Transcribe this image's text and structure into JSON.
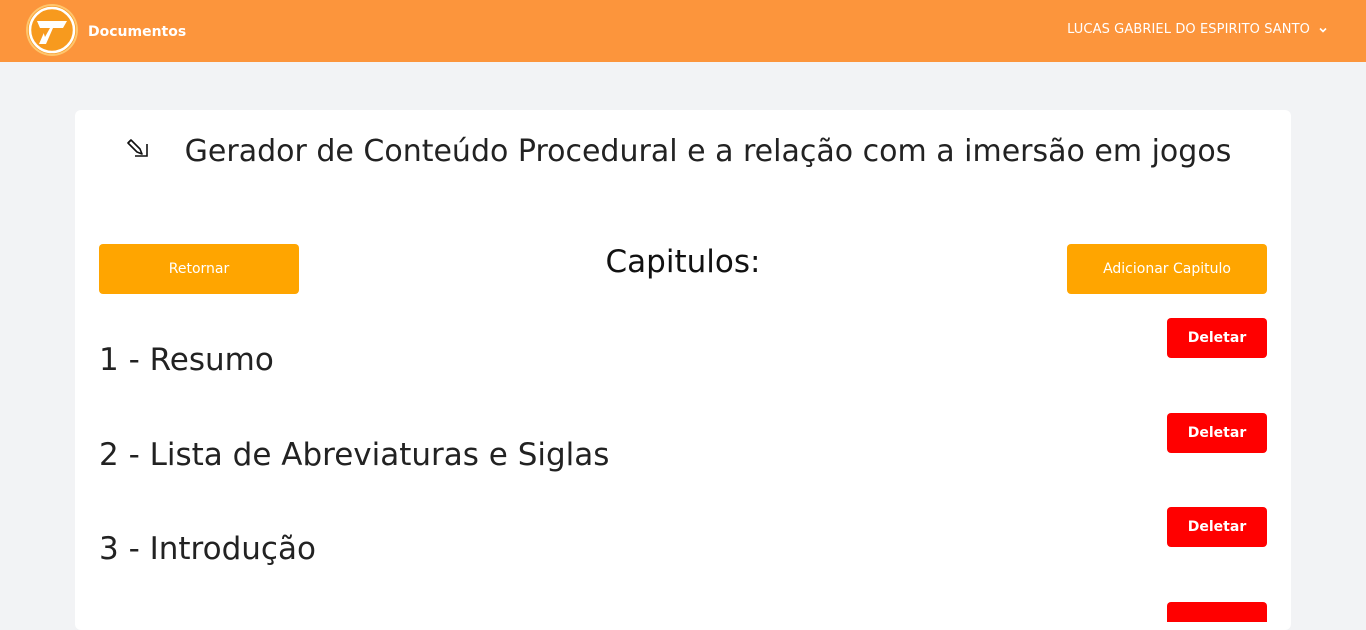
{
  "header": {
    "brand": "Documentos",
    "user_name": "LUCAS GABRIEL DO ESPIRITO SANTO"
  },
  "document": {
    "title": "Gerador de Conteúdo Procedural e a relação com a imersão em jogos"
  },
  "actions": {
    "back_label": "Retornar",
    "add_label": "Adicionar Capitulo"
  },
  "chapters_heading": "Capitulos:",
  "chapters": [
    {
      "label": "1 - Resumo",
      "delete_label": "Deletar"
    },
    {
      "label": "2 - Lista de Abreviaturas e Siglas",
      "delete_label": "Deletar"
    },
    {
      "label": "3 - Introdução",
      "delete_label": "Deletar"
    }
  ],
  "colors": {
    "header": "#fc953c",
    "primary_button": "#ffa500",
    "danger_button": "#ff0000",
    "page_background": "#f2f3f5"
  }
}
